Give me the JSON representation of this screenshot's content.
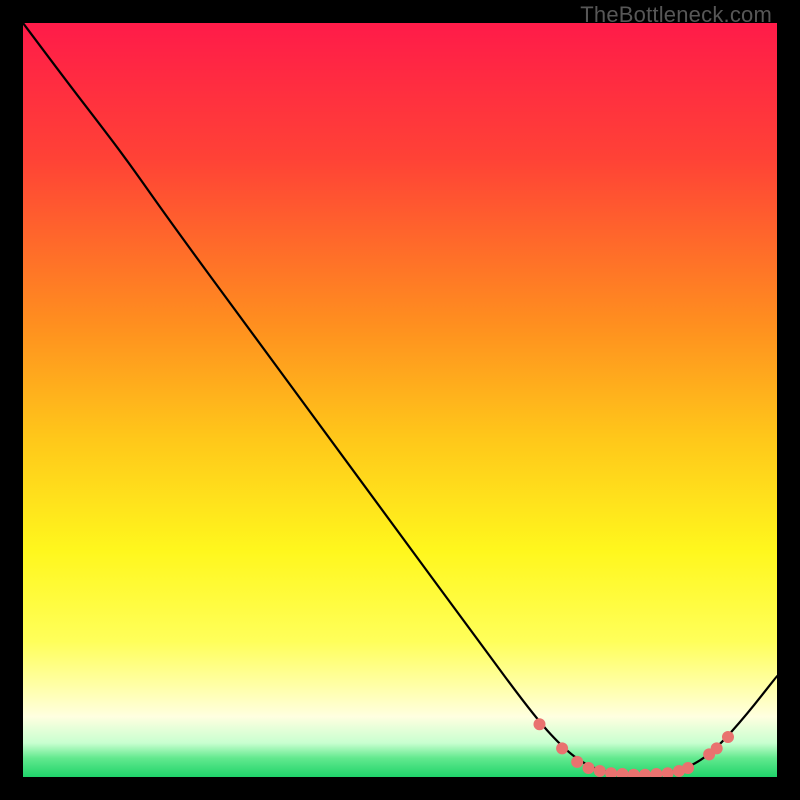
{
  "watermark": "TheBottleneck.com",
  "chart_data": {
    "type": "line",
    "title": "",
    "xlabel": "",
    "ylabel": "",
    "xlim": [
      0,
      100
    ],
    "ylim": [
      0,
      100
    ],
    "gradient_stops": [
      {
        "offset": 0.0,
        "color": "#ff1b49"
      },
      {
        "offset": 0.18,
        "color": "#ff4236"
      },
      {
        "offset": 0.4,
        "color": "#ff8f1f"
      },
      {
        "offset": 0.55,
        "color": "#ffc71a"
      },
      {
        "offset": 0.7,
        "color": "#fff71d"
      },
      {
        "offset": 0.82,
        "color": "#ffff5a"
      },
      {
        "offset": 0.88,
        "color": "#ffffa8"
      },
      {
        "offset": 0.92,
        "color": "#ffffe0"
      },
      {
        "offset": 0.955,
        "color": "#c8ffd0"
      },
      {
        "offset": 0.975,
        "color": "#62e98e"
      },
      {
        "offset": 1.0,
        "color": "#1fd36a"
      }
    ],
    "series": [
      {
        "name": "curve",
        "type": "line",
        "points": [
          {
            "x": 0.0,
            "y": 100.0
          },
          {
            "x": 6.0,
            "y": 92.0
          },
          {
            "x": 11.0,
            "y": 85.5
          },
          {
            "x": 14.0,
            "y": 81.5
          },
          {
            "x": 20.0,
            "y": 73.0
          },
          {
            "x": 30.0,
            "y": 59.4
          },
          {
            "x": 40.0,
            "y": 45.8
          },
          {
            "x": 50.0,
            "y": 32.2
          },
          {
            "x": 60.0,
            "y": 18.6
          },
          {
            "x": 68.0,
            "y": 7.8
          },
          {
            "x": 72.0,
            "y": 3.5
          },
          {
            "x": 75.0,
            "y": 1.4
          },
          {
            "x": 78.0,
            "y": 0.5
          },
          {
            "x": 82.0,
            "y": 0.3
          },
          {
            "x": 86.0,
            "y": 0.6
          },
          {
            "x": 89.0,
            "y": 1.6
          },
          {
            "x": 92.0,
            "y": 3.8
          },
          {
            "x": 96.0,
            "y": 8.3
          },
          {
            "x": 100.0,
            "y": 13.4
          }
        ]
      },
      {
        "name": "markers",
        "type": "scatter",
        "color": "#e9726f",
        "points": [
          {
            "x": 68.5,
            "y": 7.0
          },
          {
            "x": 71.5,
            "y": 3.8
          },
          {
            "x": 73.5,
            "y": 2.0
          },
          {
            "x": 75.0,
            "y": 1.2
          },
          {
            "x": 76.5,
            "y": 0.8
          },
          {
            "x": 78.0,
            "y": 0.5
          },
          {
            "x": 79.5,
            "y": 0.4
          },
          {
            "x": 81.0,
            "y": 0.3
          },
          {
            "x": 82.5,
            "y": 0.3
          },
          {
            "x": 84.0,
            "y": 0.4
          },
          {
            "x": 85.5,
            "y": 0.5
          },
          {
            "x": 87.0,
            "y": 0.8
          },
          {
            "x": 88.2,
            "y": 1.2
          },
          {
            "x": 91.0,
            "y": 3.0
          },
          {
            "x": 92.0,
            "y": 3.8
          },
          {
            "x": 93.5,
            "y": 5.3
          }
        ]
      }
    ]
  }
}
